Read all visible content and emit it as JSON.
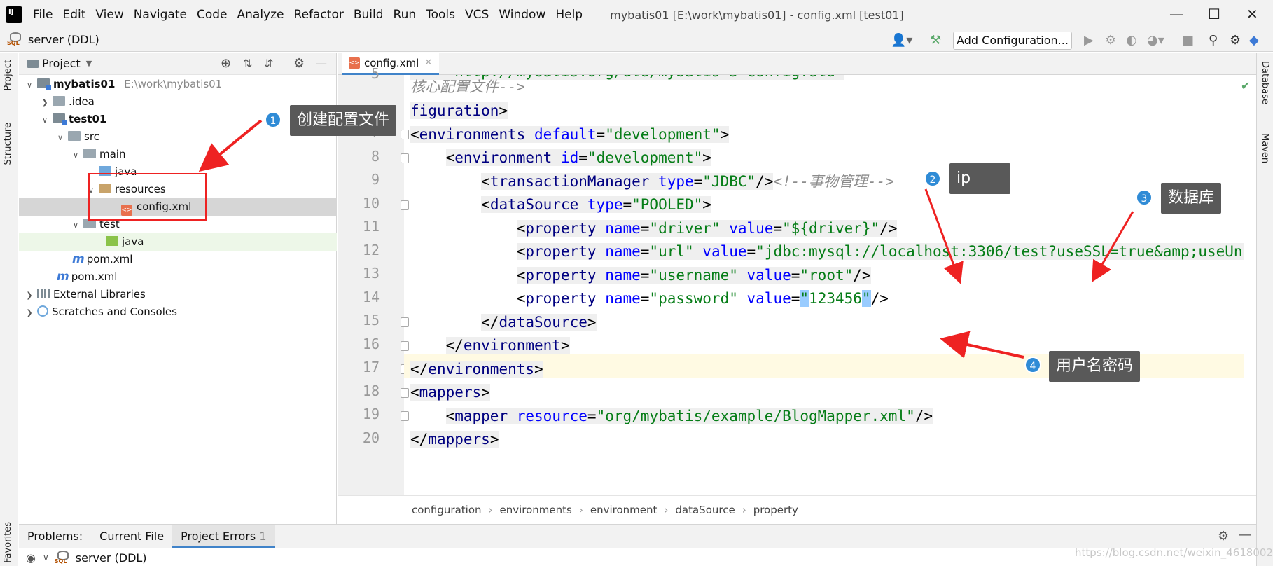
{
  "menu": {
    "items": [
      "File",
      "Edit",
      "View",
      "Navigate",
      "Code",
      "Analyze",
      "Refactor",
      "Build",
      "Run",
      "Tools",
      "VCS",
      "Window",
      "Help"
    ],
    "window_title": "mybatis01 [E:\\work\\mybatis01] - config.xml [test01]"
  },
  "navbar": {
    "db_label": "server (DDL)",
    "add_config_label": "Add Configuration..."
  },
  "side_tabs": {
    "left": [
      "Project",
      "Structure",
      "Favorites"
    ],
    "right": [
      "Database",
      "Maven"
    ]
  },
  "project_panel": {
    "title": "Project",
    "tree": [
      {
        "label": "mybatis01",
        "hint": "E:\\work\\mybatis01"
      },
      {
        "label": ".idea"
      },
      {
        "label": "test01"
      },
      {
        "label": "src"
      },
      {
        "label": "main"
      },
      {
        "label": "java"
      },
      {
        "label": "resources"
      },
      {
        "label": "config.xml"
      },
      {
        "label": "test"
      },
      {
        "label": "java"
      },
      {
        "label": "pom.xml"
      },
      {
        "label": "pom.xml"
      },
      {
        "label": "External Libraries"
      },
      {
        "label": "Scratches and Consoles"
      }
    ]
  },
  "editor": {
    "tab_label": "config.xml",
    "line_numbers": [
      "5",
      "",
      "",
      "7",
      "8",
      "9",
      "10",
      "11",
      "12",
      "13",
      "14",
      "15",
      "16",
      "17",
      "18",
      "19",
      "20"
    ],
    "breadcrumbs": [
      "configuration",
      "environments",
      "environment",
      "dataSource",
      "property"
    ]
  },
  "bottom": {
    "tabs": [
      "Problems:",
      "Current File",
      "Project Errors"
    ],
    "project_errors_count": "1",
    "db_label": "server (DDL)",
    "watermark": "https://blog.csdn.net/weixin_46180024"
  },
  "annotations": [
    {
      "num": "1",
      "text": "创建配置文件"
    },
    {
      "num": "2",
      "text": "ip"
    },
    {
      "num": "3",
      "text": "数据库"
    },
    {
      "num": "4",
      "text": "用户名密码"
    }
  ],
  "colors": {
    "accent": "#4083c9",
    "annotation_arrow": "#ee2222",
    "badge": "#2f8bd6",
    "callout_bg": "#595959",
    "tag": "#000080",
    "attr": "#0000ff",
    "string": "#067d17"
  }
}
